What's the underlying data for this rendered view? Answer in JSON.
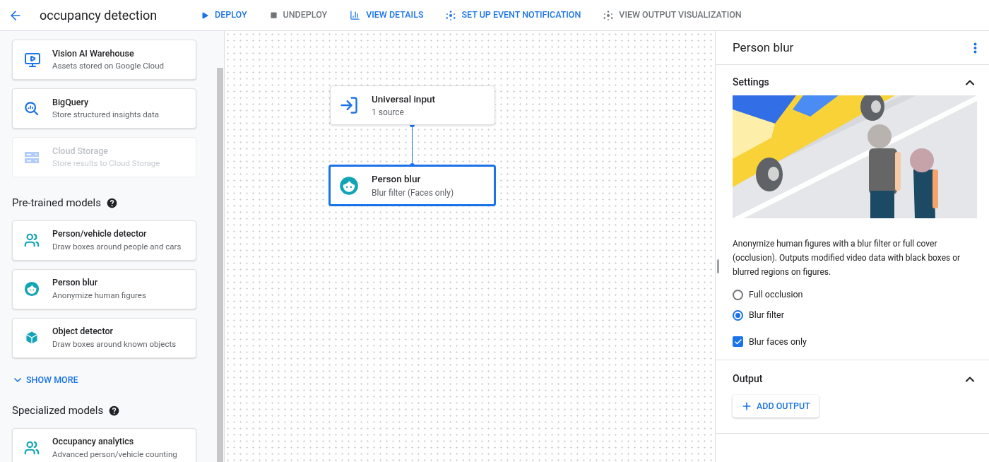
{
  "header": {
    "title": "occupancy detection",
    "actions": [
      {
        "label": "DEPLOY",
        "kind": "play",
        "disabled": false
      },
      {
        "label": "UNDEPLOY",
        "kind": "stop",
        "disabled": true
      },
      {
        "label": "VIEW DETAILS",
        "kind": "chart",
        "disabled": false
      },
      {
        "label": "SET UP EVENT NOTIFICATION",
        "kind": "hub",
        "disabled": false
      },
      {
        "label": "VIEW OUTPUT VISUALIZATION",
        "kind": "hub",
        "disabled": true
      }
    ]
  },
  "sidebar": {
    "sections": [
      {
        "items": [
          {
            "title": "Vision AI Warehouse",
            "subtitle": "Assets stored on Google Cloud",
            "kind": "monitor",
            "disabled": false
          },
          {
            "title": "BigQuery",
            "subtitle": "Store structured insights data",
            "kind": "bigquery",
            "disabled": false
          },
          {
            "title": "Cloud Storage",
            "subtitle": "Store results to Cloud Storage",
            "kind": "storage",
            "disabled": true
          }
        ]
      },
      {
        "heading": "Pre-trained models",
        "items": [
          {
            "title": "Person/vehicle detector",
            "subtitle": "Draw boxes around people and cars",
            "kind": "people",
            "disabled": false
          },
          {
            "title": "Person blur",
            "subtitle": "Anonymize human figures",
            "kind": "face",
            "disabled": false
          },
          {
            "title": "Object detector",
            "subtitle": "Draw boxes around known objects",
            "kind": "cube",
            "disabled": false
          }
        ],
        "show_more": "SHOW MORE"
      },
      {
        "heading": "Specialized models",
        "items": [
          {
            "title": "Occupancy analytics",
            "subtitle": "Advanced person/vehicle counting",
            "kind": "people",
            "disabled": false
          }
        ]
      }
    ]
  },
  "canvas": {
    "nodes": [
      {
        "title": "Universal input",
        "subtitle": "1 source",
        "kind": "input",
        "selected": false
      },
      {
        "title": "Person blur",
        "subtitle": "Blur filter (Faces only)",
        "kind": "face",
        "selected": true
      }
    ]
  },
  "panel": {
    "title": "Person blur",
    "settings": {
      "title": "Settings",
      "expanded": true,
      "description": "Anonymize human figures with a blur filter or full cover (occlusion). Outputs modified video data with black boxes or blurred regions on figures.",
      "options": [
        {
          "label": "Full occlusion",
          "selected": false
        },
        {
          "label": "Blur filter",
          "selected": true
        }
      ],
      "checkbox": {
        "label": "Blur faces only",
        "checked": true
      }
    },
    "output": {
      "title": "Output",
      "expanded": true,
      "button": "ADD OUTPUT"
    }
  }
}
